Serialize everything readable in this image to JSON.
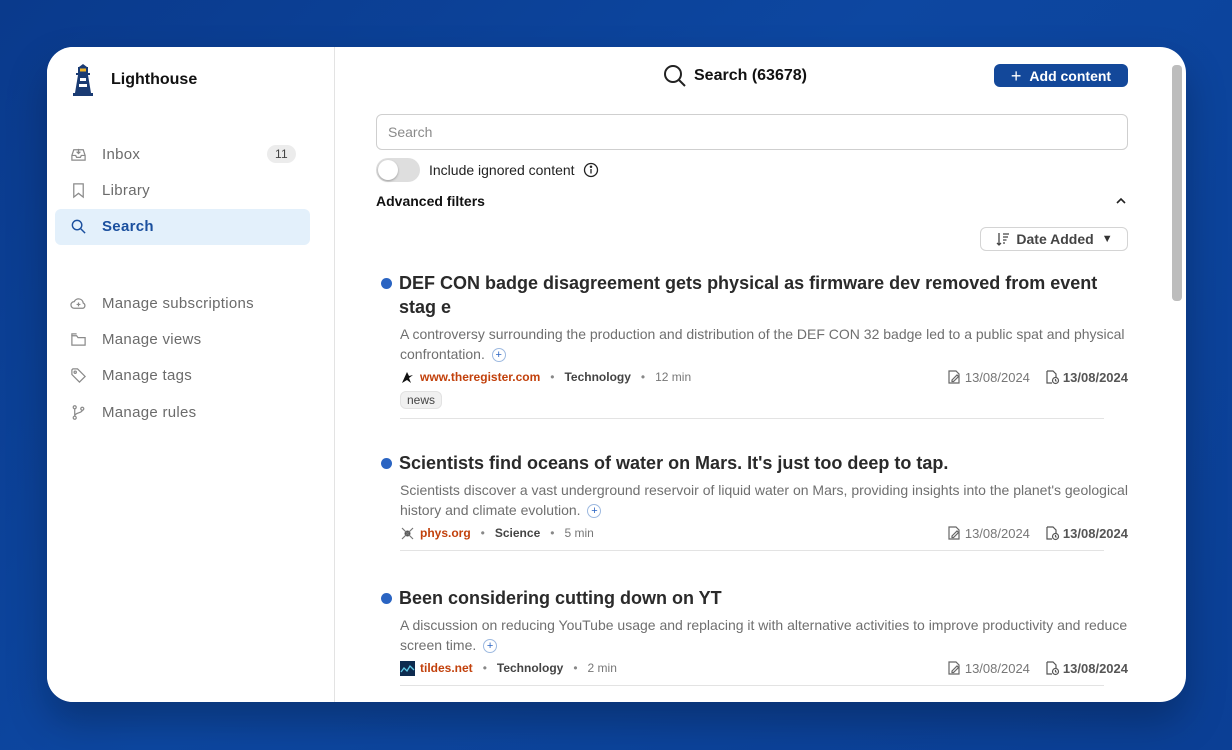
{
  "app": {
    "name": "Lighthouse"
  },
  "sidebar": {
    "primary": [
      {
        "label": "Inbox",
        "icon": "inbox-icon",
        "badge": "11"
      },
      {
        "label": "Library",
        "icon": "bookmark-icon"
      },
      {
        "label": "Search",
        "icon": "search-icon",
        "active": true
      }
    ],
    "secondary": [
      {
        "label": "Manage subscriptions",
        "icon": "cloud-icon"
      },
      {
        "label": "Manage views",
        "icon": "folder-icon"
      },
      {
        "label": "Manage tags",
        "icon": "tag-icon"
      },
      {
        "label": "Manage rules",
        "icon": "branch-icon"
      }
    ]
  },
  "header": {
    "title": "Search (63678)",
    "add_label": "Add content"
  },
  "search": {
    "placeholder": "Search",
    "value": ""
  },
  "toggle": {
    "label": "Include ignored content",
    "on": false
  },
  "filters": {
    "label": "Advanced filters"
  },
  "sort": {
    "label": "Date Added"
  },
  "items": [
    {
      "title": "DEF CON badge disagreement gets physical as firmware dev removed from event stag e",
      "description": "A controversy surrounding the production and distribution of the DEF CON 32 badge led to a public spat and physical confrontation.",
      "domain": "www.theregister.com",
      "category": "Technology",
      "read_time": "12 min",
      "date_published": "13/08/2024",
      "date_added": "13/08/2024",
      "tags": [
        "news"
      ]
    },
    {
      "title": "Scientists find oceans of water on Mars. It's just too deep to tap.",
      "description": "Scientists discover a vast underground reservoir of liquid water on Mars, providing insights into the planet's geological history and climate evolution.",
      "domain": "phys.org",
      "category": "Science",
      "read_time": "5 min",
      "date_published": "13/08/2024",
      "date_added": "13/08/2024",
      "tags": []
    },
    {
      "title": "Been considering cutting down on YT",
      "description": "A discussion on reducing YouTube usage and replacing it with alternative activities to improve productivity and reduce screen time.",
      "domain": "tildes.net",
      "category": "Technology",
      "read_time": "2 min",
      "date_published": "13/08/2024",
      "date_added": "13/08/2024",
      "tags": []
    }
  ],
  "colors": {
    "accent": "#13489a",
    "domain": "#c2410c",
    "unread_dot": "#2a64c2",
    "background": "#0d47a1"
  }
}
